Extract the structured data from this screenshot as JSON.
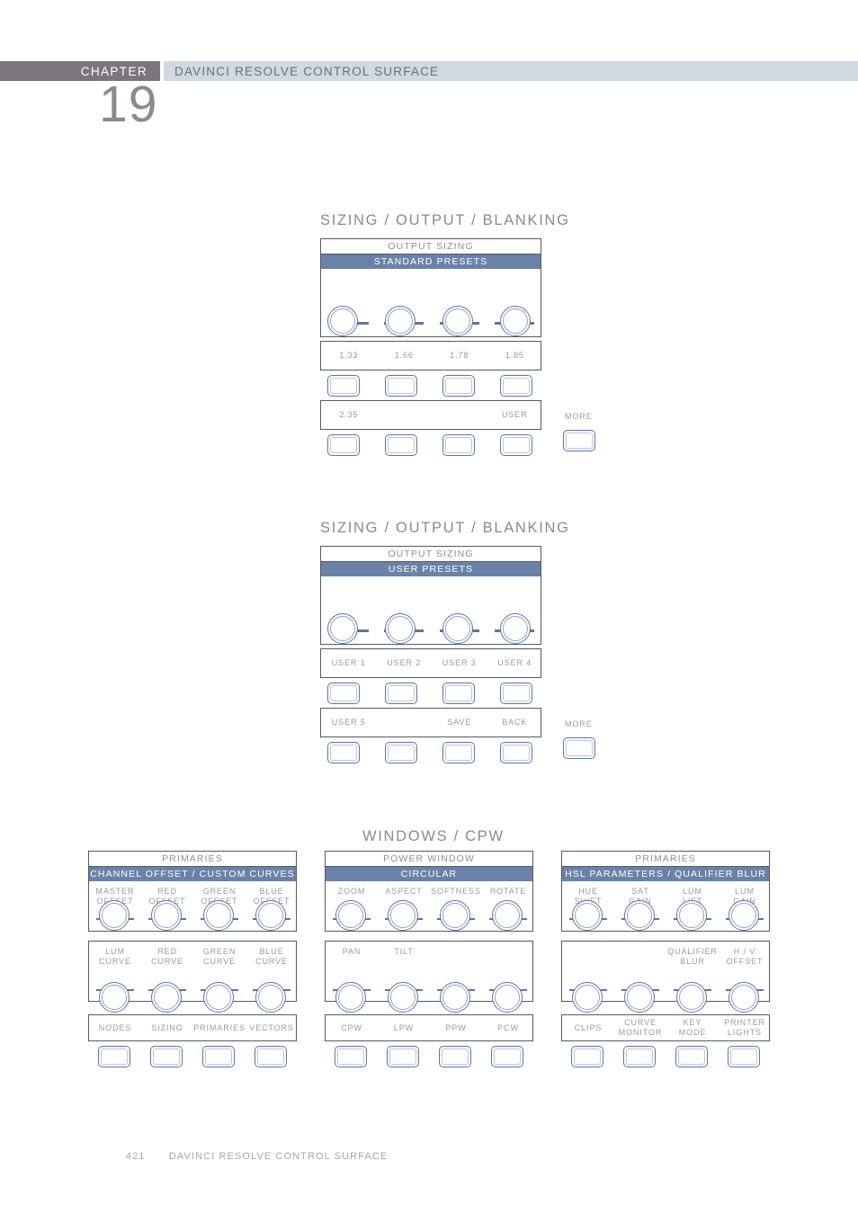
{
  "header": {
    "chapter_label": "CHAPTER",
    "chapter_number": "19",
    "title": "DAVINCI RESOLVE CONTROL SURFACE"
  },
  "footer": {
    "page": "421",
    "title": "DAVINCI RESOLVE CONTROL SURFACE"
  },
  "sections": [
    {
      "title": "SIZING / OUTPUT / BLANKING",
      "panel": {
        "subtitle": "OUTPUT SIZING",
        "bar": "STANDARD PRESETS"
      },
      "knob_labels": [
        "",
        "",
        "",
        ""
      ],
      "row_labels": [
        "1.33",
        "1.66",
        "1.78",
        "1.85"
      ],
      "row2_labels": [
        "2.35",
        "",
        "",
        "USER"
      ],
      "more_label": "MORE"
    },
    {
      "title": "SIZING / OUTPUT / BLANKING",
      "panel": {
        "subtitle": "OUTPUT SIZING",
        "bar": "USER PRESETS"
      },
      "knob_labels": [
        "",
        "",
        "",
        ""
      ],
      "row_labels": [
        "USER 1",
        "USER 2",
        "USER 3",
        "USER 4"
      ],
      "row2_labels": [
        "USER 5",
        "",
        "SAVE",
        "BACK"
      ],
      "more_label": "MORE"
    }
  ],
  "windows_section": {
    "title": "WINDOWS / CPW",
    "panels": [
      {
        "subtitle": "PRIMARIES",
        "bar": "CHANNEL OFFSET / CUSTOM CURVES",
        "knobs_row1": [
          "MASTER\nOFFSET",
          "RED\nOFFSET",
          "GREEN\nOFFSET",
          "BLUE\nOFFSET"
        ],
        "knobs_row2": [
          "LUM\nCURVE",
          "RED\nCURVE",
          "GREEN\nCURVE",
          "BLUE\nCURVE"
        ],
        "buttons": [
          "NODES",
          "SIZING",
          "PRIMARIES",
          "VECTORS"
        ]
      },
      {
        "subtitle": "POWER WINDOW",
        "bar": "CIRCULAR",
        "knobs_row1": [
          "ZOOM",
          "ASPECT",
          "SOFTNESS",
          "ROTATE"
        ],
        "knobs_row2": [
          "PAN",
          "TILT",
          "",
          ""
        ],
        "buttons": [
          "CPW",
          "LPW",
          "PPW",
          "PCW"
        ]
      },
      {
        "subtitle": "PRIMARIES",
        "bar": "HSL PARAMETERS / QUALIFIER BLUR",
        "knobs_row1": [
          "HUE\nSHIFT",
          "SAT\nGAIN",
          "LUM\nLIFT",
          "LUM\nGAIN"
        ],
        "knobs_row2": [
          "",
          "",
          "QUALIFIER\nBLUR",
          "H / V\nOFFSET"
        ],
        "buttons": [
          "CLIPS",
          "CURVE\nMONITOR",
          "KEY\nMODE",
          "PRINTER\nLIGHTS"
        ]
      }
    ]
  },
  "colors": {
    "bar_blue": "#6b82a8",
    "outline": "#555a63",
    "knob_blue": "#5d76a6",
    "header_chapter_bg": "#7d757e",
    "header_title_bg": "#cfd9de",
    "text_gray": "#9a9aa2"
  }
}
